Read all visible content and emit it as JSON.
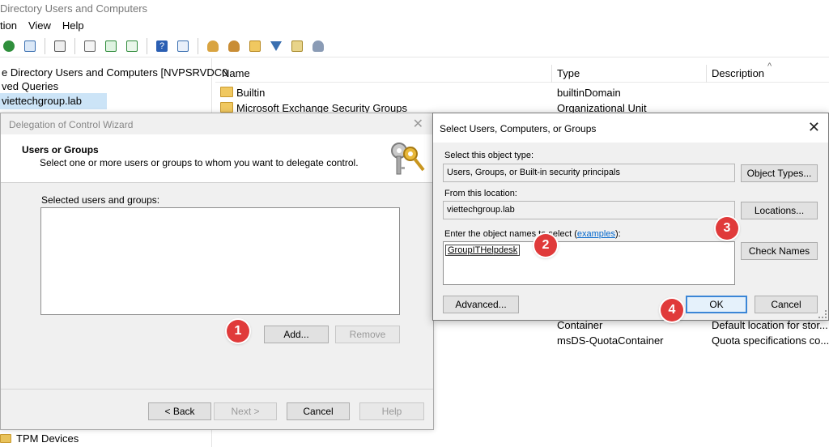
{
  "window": {
    "title": "Directory Users and Computers",
    "menu": [
      "tion",
      "View",
      "Help"
    ]
  },
  "tree": {
    "items": [
      "e Directory Users and Computers [NVPSRVDC0",
      "ved Queries",
      "viettechgroup.lab"
    ],
    "bottom_item": "TPM Devices"
  },
  "list": {
    "columns": [
      "Name",
      "Type",
      "Description"
    ],
    "rows": [
      {
        "name": "Builtin",
        "type": "builtinDomain",
        "description": ""
      },
      {
        "name": "Microsoft Exchange Security Groups",
        "type": "Organizational Unit",
        "description": ""
      },
      {
        "name": "",
        "type": "Container",
        "description": "Default location for stor..."
      },
      {
        "name": "",
        "type": "msDS-QuotaContainer",
        "description": "Quota specifications co..."
      }
    ]
  },
  "wizard": {
    "title": "Delegation of Control Wizard",
    "header_title": "Users or Groups",
    "header_subtitle": "Select one or more users or groups to whom you want to delegate control.",
    "list_label": "Selected users and groups:",
    "add_label": "Add...",
    "remove_label": "Remove",
    "back_label": "< Back",
    "next_label": "Next >",
    "cancel_label": "Cancel",
    "help_label": "Help"
  },
  "select_dialog": {
    "title": "Select Users, Computers, or Groups",
    "object_type_label": "Select this object type:",
    "object_type_value": "Users, Groups, or Built-in security principals",
    "object_types_button": "Object Types...",
    "location_label": "From this location:",
    "location_value": "viettechgroup.lab",
    "locations_button": "Locations...",
    "names_label_prefix": "Enter the object names to select (",
    "names_label_link": "examples",
    "names_label_suffix": "):",
    "names_value": "GroupITHelpdesk",
    "check_names_button": "Check Names",
    "advanced_button": "Advanced...",
    "ok_button": "OK",
    "cancel_button": "Cancel"
  },
  "steps": [
    "1",
    "2",
    "3",
    "4"
  ]
}
